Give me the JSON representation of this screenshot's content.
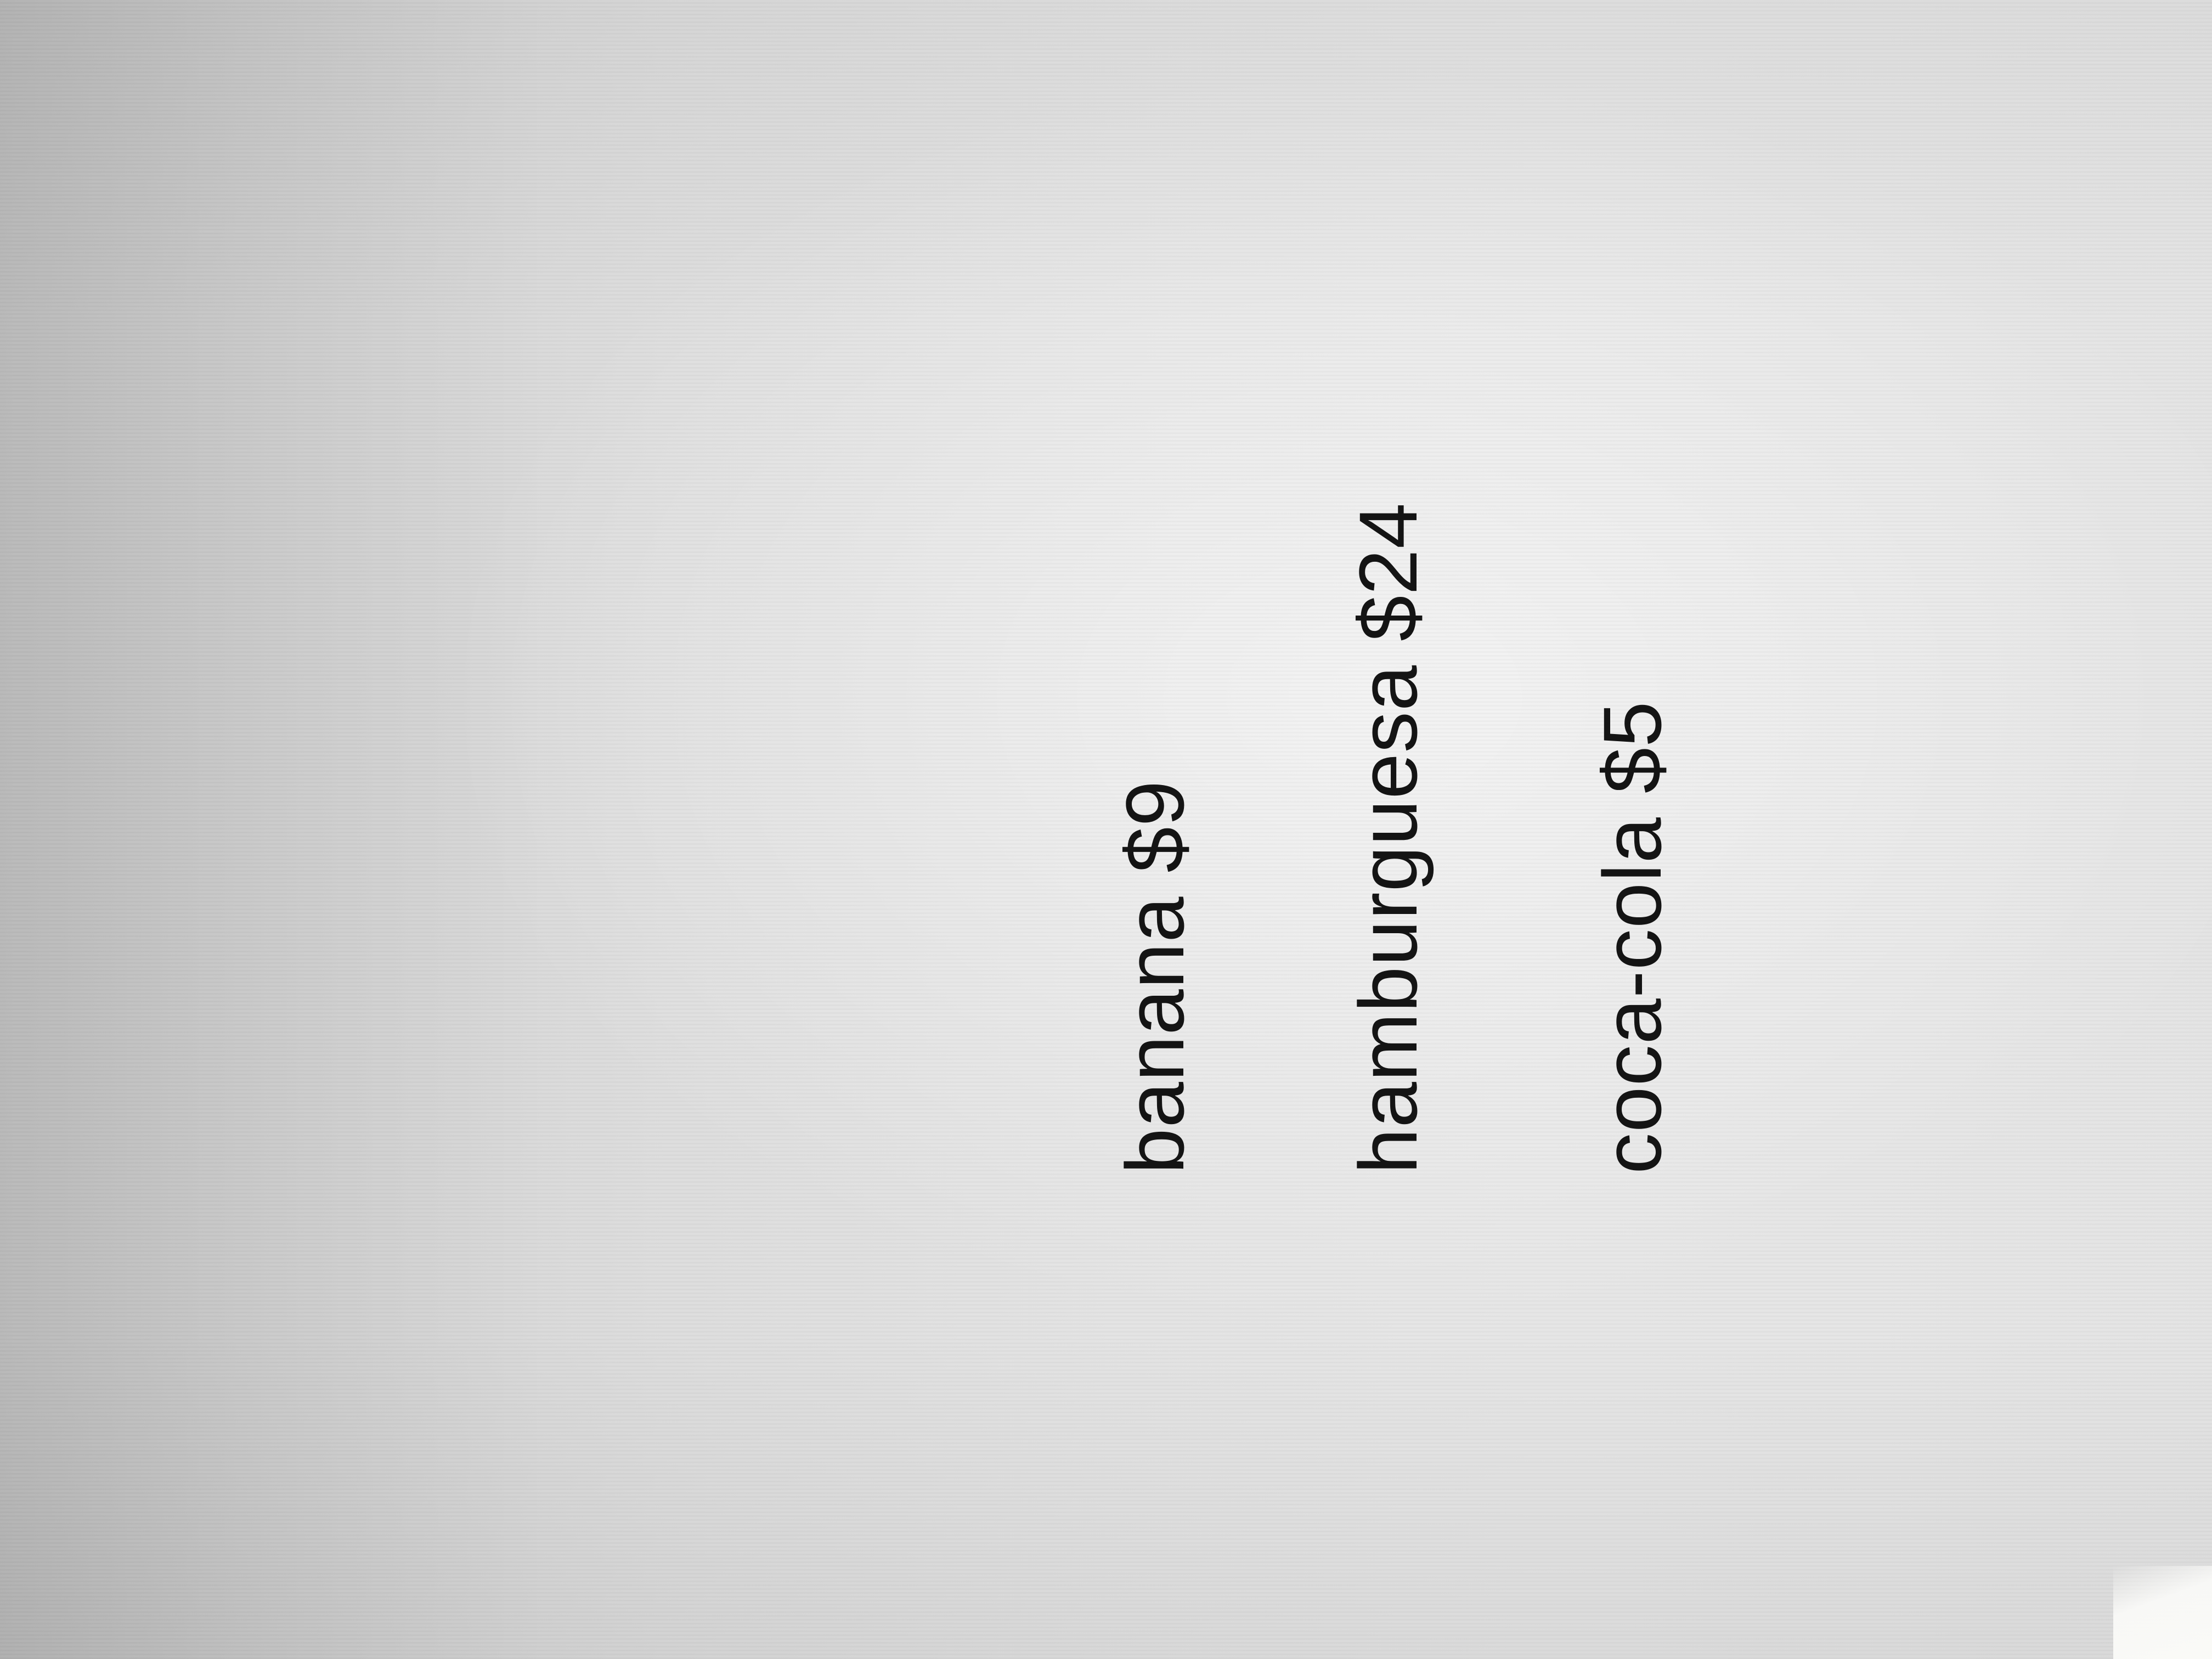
{
  "items": [
    {
      "text": "banana $9"
    },
    {
      "text": "hamburguesa $24"
    },
    {
      "text": "coca-cola $5"
    }
  ],
  "colors": {
    "text": "#141414",
    "paper": "#e2e2e2"
  }
}
